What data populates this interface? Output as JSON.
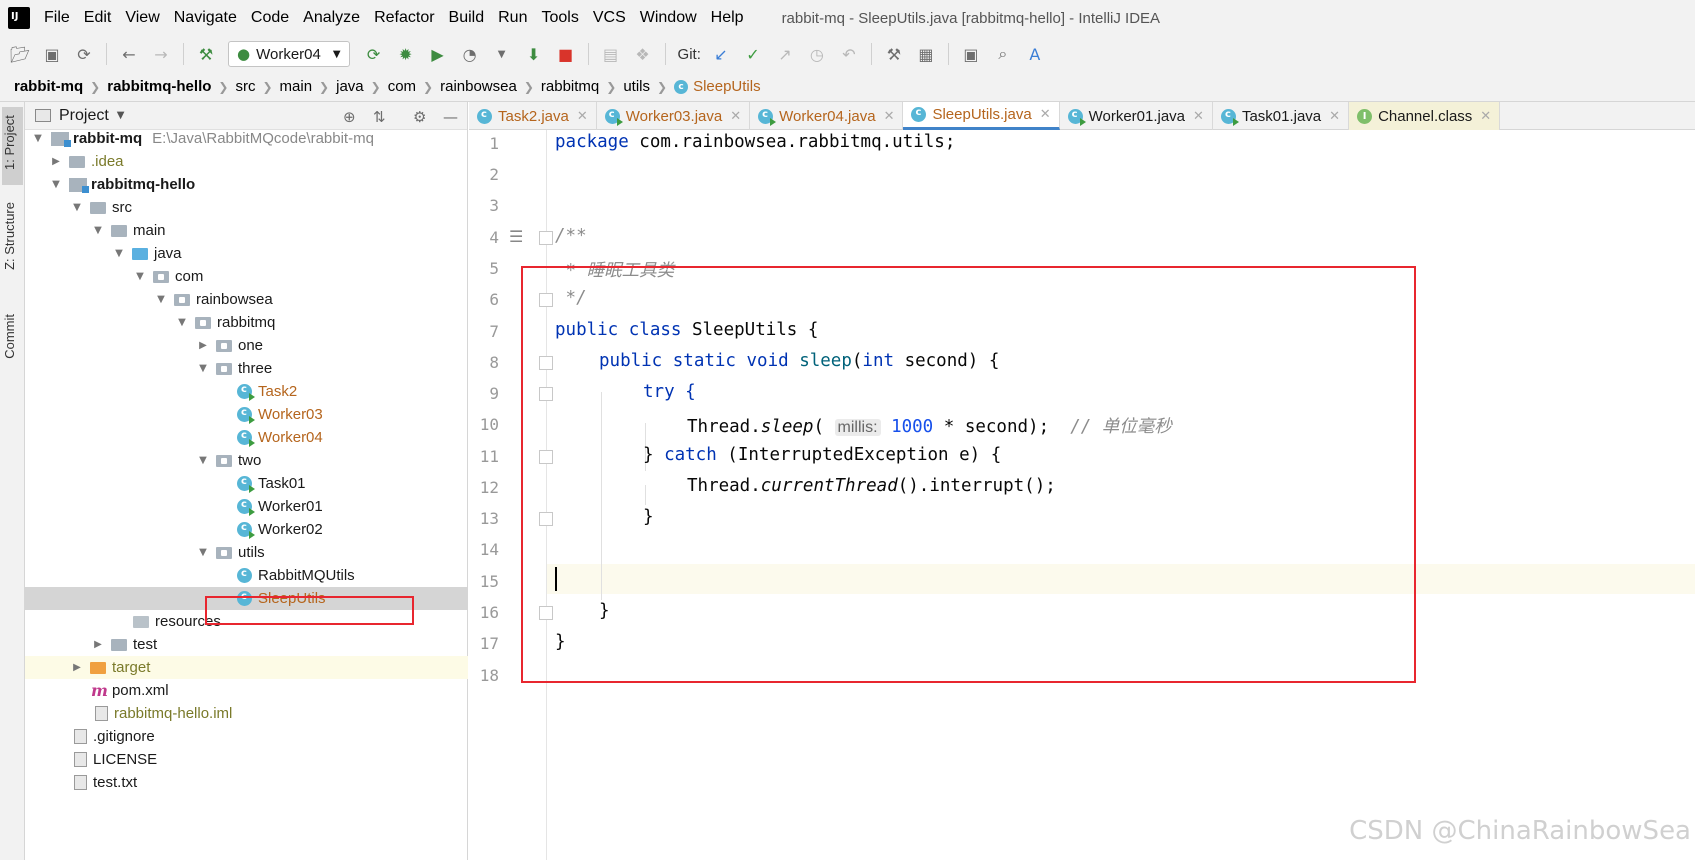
{
  "menubar": {
    "items": [
      "File",
      "Edit",
      "View",
      "Navigate",
      "Code",
      "Analyze",
      "Refactor",
      "Build",
      "Run",
      "Tools",
      "VCS",
      "Window",
      "Help"
    ],
    "window_title": "rabbit-mq - SleepUtils.java [rabbitmq-hello] - IntelliJ IDEA"
  },
  "toolbar": {
    "run_config": "Worker04",
    "git_label": "Git:"
  },
  "breadcrumb": [
    "rabbit-mq",
    "rabbitmq-hello",
    "src",
    "main",
    "java",
    "com",
    "rainbowsea",
    "rabbitmq",
    "utils"
  ],
  "breadcrumb_file": "SleepUtils",
  "left_strip": {
    "project": "1: Project",
    "structure": "Z: Structure",
    "commit": "Commit"
  },
  "project_panel": {
    "title": "Project",
    "tree": [
      {
        "label": "rabbit-mq",
        "extra": "E:\\Java\\RabbitMQcode\\rabbit-mq"
      },
      {
        "label": ".idea"
      },
      {
        "label": "rabbitmq-hello"
      },
      {
        "label": "src"
      },
      {
        "label": "main"
      },
      {
        "label": "java"
      },
      {
        "label": "com"
      },
      {
        "label": "rainbowsea"
      },
      {
        "label": "rabbitmq"
      },
      {
        "label": "one"
      },
      {
        "label": "three"
      },
      {
        "label": "Task2"
      },
      {
        "label": "Worker03"
      },
      {
        "label": "Worker04"
      },
      {
        "label": "two"
      },
      {
        "label": "Task01"
      },
      {
        "label": "Worker01"
      },
      {
        "label": "Worker02"
      },
      {
        "label": "utils"
      },
      {
        "label": "RabbitMQUtils"
      },
      {
        "label": "SleepUtils"
      },
      {
        "label": "resources"
      },
      {
        "label": "test"
      },
      {
        "label": "target"
      },
      {
        "label": "pom.xml"
      },
      {
        "label": "rabbitmq-hello.iml"
      },
      {
        "label": ".gitignore"
      },
      {
        "label": "LICENSE"
      },
      {
        "label": "test.txt"
      }
    ]
  },
  "editor_tabs": [
    "Task2.java",
    "Worker03.java",
    "Worker04.java",
    "SleepUtils.java",
    "Worker01.java",
    "Task01.java",
    "Channel.class"
  ],
  "editor": {
    "line_numbers": [
      "1",
      "2",
      "3",
      "4",
      "5",
      "6",
      "7",
      "8",
      "9",
      "10",
      "11",
      "12",
      "13",
      "14",
      "15",
      "16",
      "17",
      "18"
    ],
    "code": {
      "l1_kw": "package",
      "l1_rest": " com.rainbowsea.rabbitmq.utils;",
      "l4": "/**",
      "l5": " * 睡眠工具类",
      "l6": " */",
      "l7_kw": "public class",
      "l7_rest": " SleepUtils {",
      "l8_kw": "public static void",
      "l8_fn": " sleep",
      "l8_p1": "(",
      "l8_kw2": "int",
      "l8_rest": " second) {",
      "l9": "try {",
      "l10_a": "Thread.",
      "l10_b": "sleep",
      "l10_c": "( ",
      "l10_hint": "millis:",
      "l10_num": " 1000",
      "l10_d": " * second);  ",
      "l10_cm": "// 单位毫秒",
      "l11_a": "} ",
      "l11_kw": "catch",
      "l11_b": " (InterruptedException e) {",
      "l12_a": "Thread.",
      "l12_b": "currentThread",
      "l12_c": "().interrupt();",
      "l13": "}",
      "l16": "}",
      "l17": "}"
    }
  },
  "watermark": "CSDN @ChinaRainbowSea",
  "colors": {
    "annotation": "#e8262f",
    "selected_file": "#b5651d",
    "keyword": "#0033b3"
  }
}
